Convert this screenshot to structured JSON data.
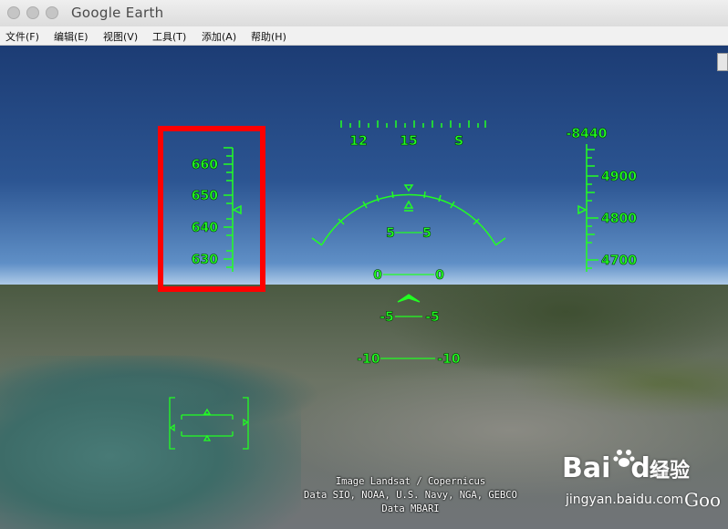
{
  "window": {
    "title": "Google Earth"
  },
  "menu": [
    "文件(F)",
    "编辑(E)",
    "视图(V)",
    "工具(T)",
    "添加(A)",
    "帮助(H)"
  ],
  "hud": {
    "heading_ticks": [
      "12",
      "15",
      "S"
    ],
    "speed_labels": [
      "660",
      "650",
      "640",
      "630"
    ],
    "altitude_top": "-8440",
    "altitude_labels": [
      "4900",
      "4800",
      "4700"
    ],
    "pitch_labels": [
      {
        "left": "5",
        "right": "5"
      },
      {
        "left": "0",
        "right": "0"
      },
      {
        "left": "-5",
        "right": "-5"
      },
      {
        "left": "-10",
        "right": "-10"
      }
    ],
    "hud_color": "#22ff22",
    "highlight_color": "#ff0000"
  },
  "credits": {
    "line1": "Image Landsat / Copernicus",
    "line2": "Data SIO, NOAA, U.S. Navy, NGA, GEBCO",
    "line3": "Data MBARI"
  },
  "watermark": {
    "logo": "Bai",
    "logo2": "du",
    "cn": "经验",
    "url": "jingyan.baidu.com"
  },
  "google_logo": "Goo"
}
